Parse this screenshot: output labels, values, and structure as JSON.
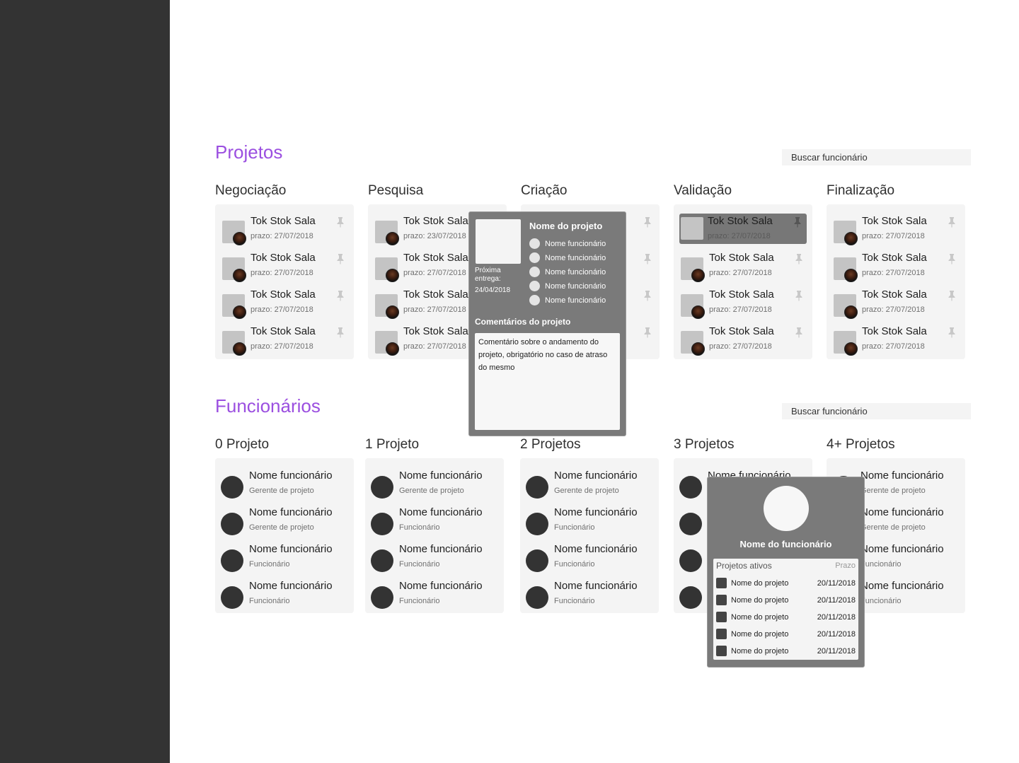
{
  "projetos": {
    "title": "Projetos",
    "search_placeholder": "Buscar funcionário",
    "columns": [
      {
        "title": "Negociação",
        "items": [
          {
            "name": "Tok Stok Sala",
            "date": "prazo: 27/07/2018"
          },
          {
            "name": "Tok Stok Sala",
            "date": "prazo: 27/07/2018"
          },
          {
            "name": "Tok Stok Sala",
            "date": "prazo: 27/07/2018"
          },
          {
            "name": "Tok Stok Sala",
            "date": "prazo: 27/07/2018"
          }
        ]
      },
      {
        "title": "Pesquisa",
        "items": [
          {
            "name": "Tok Stok Sala",
            "date": "prazo: 23/07/2018"
          },
          {
            "name": "Tok Stok Sala",
            "date": "prazo: 27/07/2018"
          },
          {
            "name": "Tok Stok Sala",
            "date": "prazo: 27/07/2018"
          },
          {
            "name": "Tok Stok Sala",
            "date": "prazo: 27/07/2018"
          }
        ]
      },
      {
        "title": "Criação",
        "items": []
      },
      {
        "title": "Validação",
        "items": [
          {
            "name": "Tok Stok Sala",
            "date": "prazo: 27/07/2018",
            "selected": true
          },
          {
            "name": "Tok Stok Sala",
            "date": "prazo: 27/07/2018"
          },
          {
            "name": "Tok Stok Sala",
            "date": "prazo: 27/07/2018"
          },
          {
            "name": "Tok Stok Sala",
            "date": "prazo: 27/07/2018"
          }
        ]
      },
      {
        "title": "Finalização",
        "items": [
          {
            "name": "Tok Stok Sala",
            "date": "prazo: 27/07/2018"
          },
          {
            "name": "Tok Stok Sala",
            "date": "prazo: 27/07/2018"
          },
          {
            "name": "Tok Stok Sala",
            "date": "prazo: 27/07/2018"
          },
          {
            "name": "Tok Stok Sala",
            "date": "prazo: 27/07/2018"
          }
        ]
      }
    ]
  },
  "project_popup": {
    "title": "Nome do projeto",
    "next_label": "Próxima entrega:",
    "next_date": "24/04/2018",
    "employees": [
      "Nome funcionário",
      "Nome funcionário",
      "Nome funcionário",
      "Nome funcionário",
      "Nome funcionário"
    ],
    "comments_title": "Comentários do projeto",
    "comment": "Comentário sobre o andamento do projeto, obrigatório no caso de atraso do mesmo"
  },
  "funcionarios": {
    "title": "Funcionários",
    "search_placeholder": "Buscar funcionário",
    "columns": [
      {
        "title": "0 Projeto",
        "items": [
          {
            "name": "Nome funcionário",
            "role": "Gerente de projeto"
          },
          {
            "name": "Nome funcionário",
            "role": "Gerente de projeto"
          },
          {
            "name": "Nome funcionário",
            "role": "Funcionário"
          },
          {
            "name": "Nome funcionário",
            "role": "Funcionário"
          }
        ]
      },
      {
        "title": "1 Projeto",
        "items": [
          {
            "name": "Nome funcionário",
            "role": "Gerente de projeto"
          },
          {
            "name": "Nome funcionário",
            "role": "Funcionário"
          },
          {
            "name": "Nome funcionário",
            "role": "Funcionário"
          },
          {
            "name": "Nome funcionário",
            "role": "Funcionário"
          }
        ]
      },
      {
        "title": "2 Projetos",
        "items": [
          {
            "name": "Nome funcionário",
            "role": "Gerente de projeto"
          },
          {
            "name": "Nome funcionário",
            "role": "Funcionário"
          },
          {
            "name": "Nome funcionário",
            "role": "Funcionário"
          },
          {
            "name": "Nome funcionário",
            "role": "Funcionário"
          }
        ]
      },
      {
        "title": "3 Projetos",
        "items": [
          {
            "name": "Nome funcionário",
            "role": ""
          },
          {
            "name": "",
            "role": ""
          },
          {
            "name": "",
            "role": ""
          },
          {
            "name": "",
            "role": ""
          }
        ]
      },
      {
        "title": "4+ Projetos",
        "items": [
          {
            "name": "Nome funcionário",
            "role": "Gerente de projeto"
          },
          {
            "name": "Nome funcionário",
            "role": "Gerente de projeto"
          },
          {
            "name": "Nome funcionário",
            "role": "Funcionário"
          },
          {
            "name": "Nome funcionário",
            "role": "Funcionário"
          }
        ]
      }
    ]
  },
  "employee_popup": {
    "name": "Nome do funcionário",
    "header_projects": "Projetos ativos",
    "header_deadline": "Prazo",
    "rows": [
      {
        "project": "Nome do projeto",
        "date": "20/11/2018"
      },
      {
        "project": "Nome do projeto",
        "date": "20/11/2018"
      },
      {
        "project": "Nome do projeto",
        "date": "20/11/2018"
      },
      {
        "project": "Nome do projeto",
        "date": "20/11/2018"
      },
      {
        "project": "Nome do projeto",
        "date": "20/11/2018"
      }
    ]
  },
  "colors": {
    "accent": "#9b4fe0",
    "sidebar": "#333333",
    "popup": "#7a7a7a"
  },
  "icons": {
    "pin": "pin-icon"
  }
}
